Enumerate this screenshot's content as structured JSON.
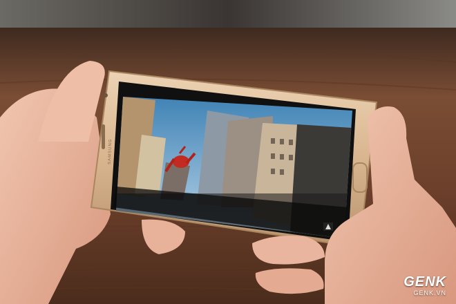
{
  "phone": {
    "brand_text": "SAMSUNG",
    "color": "#d9b58f"
  },
  "video": {
    "scene": "Spider-Man swinging between city buildings",
    "channel_logo": "logo-icon"
  },
  "watermark": {
    "brand": "GENK",
    "domain": "GENK.VN"
  },
  "colors": {
    "table": "#6b4430",
    "sky": "#4d8fc0",
    "phone_gold": "#d9b58f",
    "skin": "#e7b39b"
  }
}
